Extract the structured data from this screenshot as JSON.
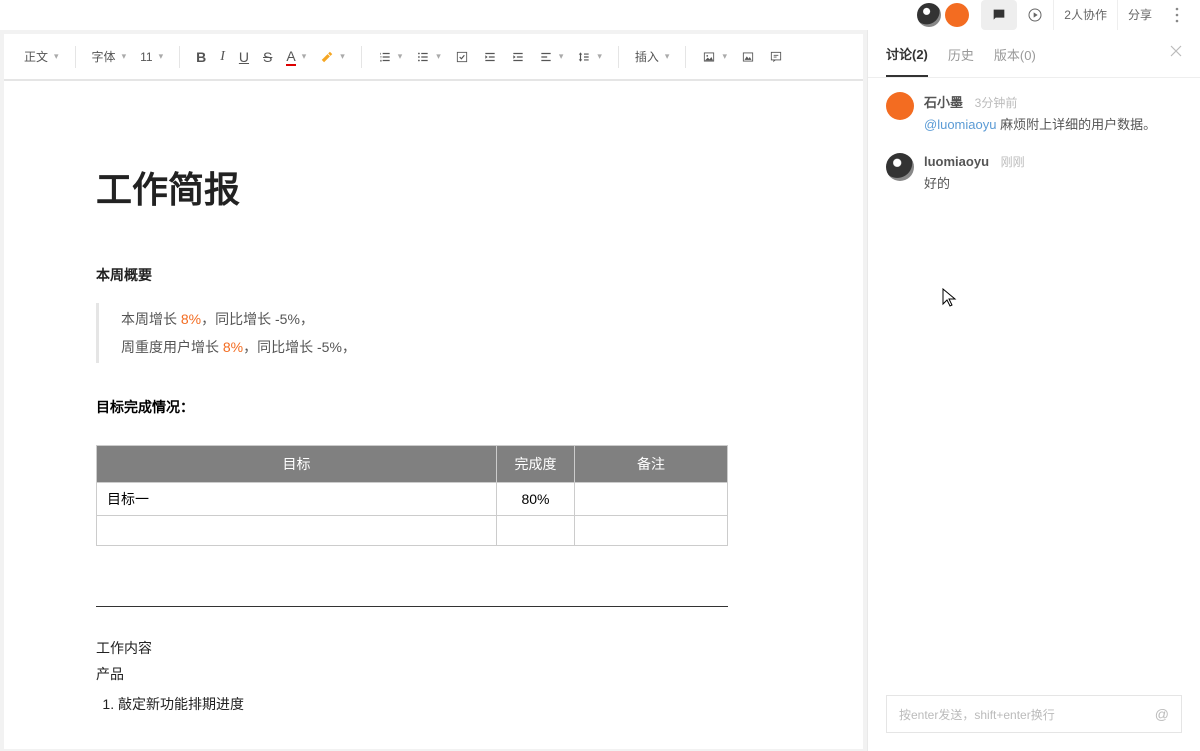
{
  "topbar": {
    "collab": "2人协作",
    "share": "分享"
  },
  "toolbar": {
    "body_text": "正文",
    "font": "字体",
    "font_size": "11",
    "insert": "插入"
  },
  "doc": {
    "title": "工作简报",
    "section1_head": "本周概要",
    "line1_pre": "本周增长 ",
    "line1_up": "8%",
    "line1_mid": "，同比增长 ",
    "line1_down": "-5%",
    "line1_post": "，",
    "line2_pre": "周重度用户增长 ",
    "line2_up": "8%",
    "line2_mid": "，同比增长 ",
    "line2_down": "-5%",
    "line2_post": "，",
    "section2_head": "目标完成情况：",
    "table": {
      "h1": "目标",
      "h2": "完成度",
      "h3": "备注",
      "rows": [
        {
          "c1": "目标一",
          "c2": "80%",
          "c3": ""
        },
        {
          "c1": "",
          "c2": "",
          "c3": ""
        }
      ]
    },
    "section3_head": "工作内容",
    "section3_sub": "产品",
    "ol_item1": "敲定新功能排期进度"
  },
  "side": {
    "tab_discuss": "讨论(2)",
    "tab_history": "历史",
    "tab_version": "版本(0)",
    "comments": [
      {
        "avatar": "orange",
        "name": "石小墨",
        "time": "3分钟前",
        "mention": "@luomiaoyu",
        "text": " 麻烦附上详细的用户数据。"
      },
      {
        "avatar": "panda",
        "name": "luomiaoyu",
        "time": "刚刚",
        "mention": "",
        "text": "好的"
      }
    ],
    "input_placeholder": "按enter发送，shift+enter换行"
  }
}
